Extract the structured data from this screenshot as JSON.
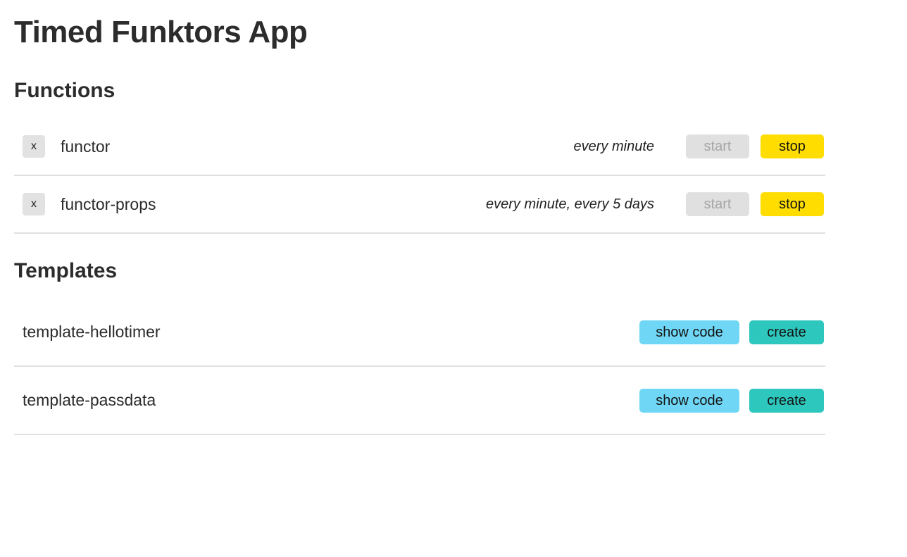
{
  "app": {
    "title": "Timed Funktors App"
  },
  "colors": {
    "stop_button": "#ffdd00",
    "start_button_disabled": "#e0e0e0",
    "show_code_button": "#6fd7f5",
    "create_button": "#2ec7bd",
    "delete_button": "#e2e2e2",
    "divider": "#e0e0e0",
    "text": "#2b2b2b"
  },
  "functions_section": {
    "heading": "Functions",
    "delete_label": "x",
    "start_label": "start",
    "stop_label": "stop",
    "items": [
      {
        "name": "functor",
        "schedule": "every minute",
        "start_label": "start",
        "stop_label": "stop",
        "delete_label": "x",
        "start_disabled": true
      },
      {
        "name": "functor-props",
        "schedule": "every minute, every 5 days",
        "start_label": "start",
        "stop_label": "stop",
        "delete_label": "x",
        "start_disabled": true
      }
    ]
  },
  "templates_section": {
    "heading": "Templates",
    "show_code_label": "show code",
    "create_label": "create",
    "items": [
      {
        "name": "template-hellotimer",
        "show_code_label": "show code",
        "create_label": "create"
      },
      {
        "name": "template-passdata",
        "show_code_label": "show code",
        "create_label": "create"
      }
    ]
  }
}
